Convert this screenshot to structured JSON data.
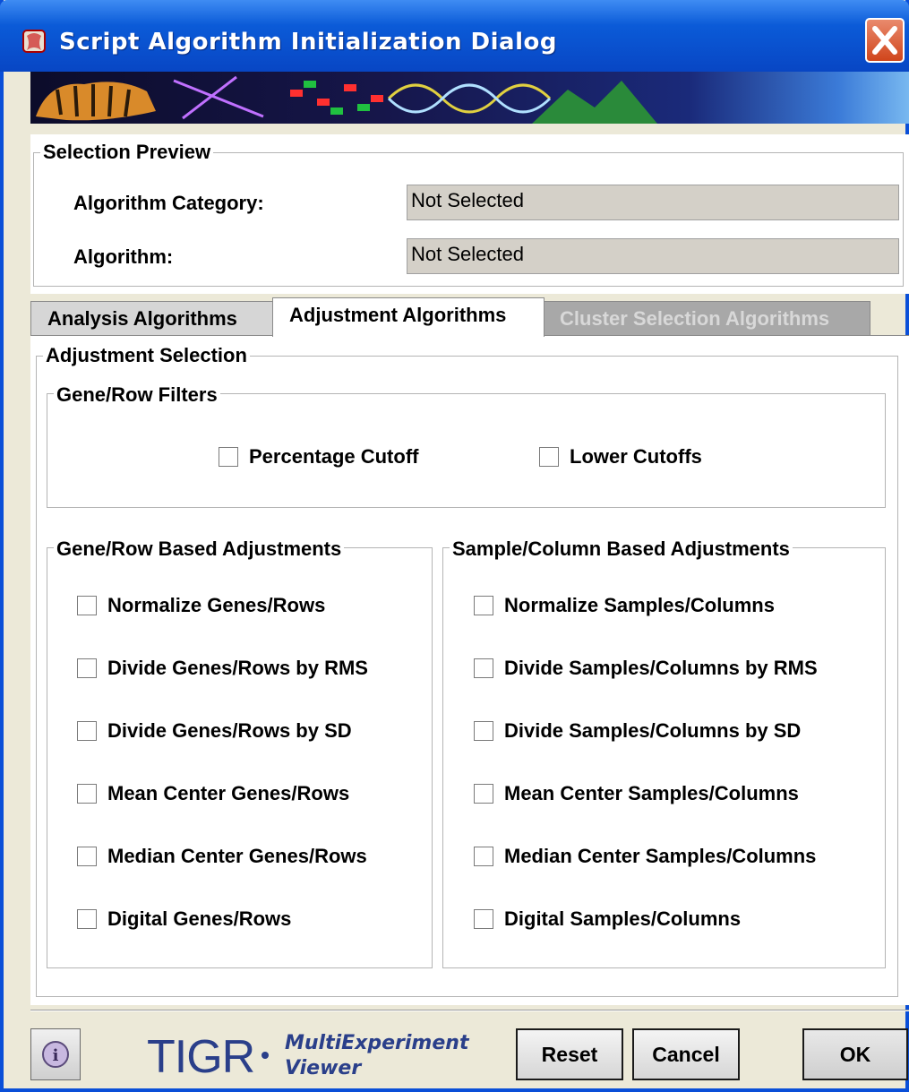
{
  "window": {
    "title": "Script Algorithm Initialization Dialog"
  },
  "preview": {
    "group_title": "Selection Preview",
    "category_label": "Algorithm Category:",
    "category_value": "Not Selected",
    "algorithm_label": "Algorithm:",
    "algorithm_value": "Not Selected"
  },
  "tabs": [
    {
      "label": "Analysis Algorithms",
      "state": "inactive"
    },
    {
      "label": "Adjustment Algorithms",
      "state": "active"
    },
    {
      "label": "Cluster Selection Algorithms",
      "state": "disabled"
    }
  ],
  "adjustment": {
    "group_title": "Adjustment Selection",
    "filters": {
      "title": "Gene/Row Filters",
      "items": [
        "Percentage Cutoff",
        "Lower Cutoffs"
      ]
    },
    "gene_row": {
      "title": "Gene/Row Based Adjustments",
      "items": [
        "Normalize Genes/Rows",
        "Divide Genes/Rows by RMS",
        "Divide Genes/Rows by SD",
        "Mean Center Genes/Rows",
        "Median Center Genes/Rows",
        "Digital Genes/Rows"
      ]
    },
    "sample_col": {
      "title": "Sample/Column Based Adjustments",
      "items": [
        "Normalize Samples/Columns",
        "Divide Samples/Columns by RMS",
        "Divide Samples/Columns by SD",
        "Mean Center Samples/Columns",
        "Median Center Samples/Columns",
        "Digital Samples/Columns"
      ]
    }
  },
  "footer": {
    "logo_text": "TIGR",
    "logo_sub1": "MultiExperiment",
    "logo_sub2": "Viewer",
    "buttons": {
      "reset": "Reset",
      "cancel": "Cancel",
      "ok": "OK"
    }
  },
  "colors": {
    "titlebar": "#0b5bd8",
    "close": "#d0451b",
    "disabled_tab_text": "#c8c8c8"
  }
}
